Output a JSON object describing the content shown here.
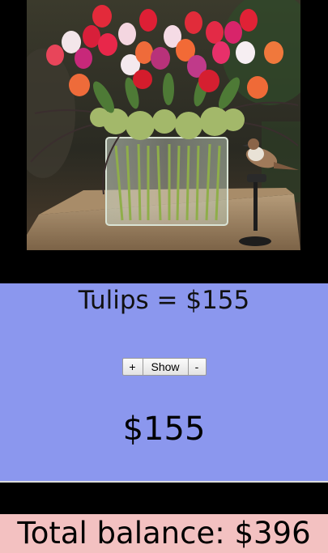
{
  "product": {
    "image_alt": "Tulip bouquet in glass vase",
    "title": "Tulips = $155",
    "amount": "$155"
  },
  "controls": {
    "plus_label": "+",
    "show_label": "Show",
    "minus_label": "-"
  },
  "total": {
    "text": "Total balance: $396"
  },
  "colors": {
    "page_background": "#000000",
    "panel_background": "#8b97ee",
    "total_background": "#f3c1c1"
  }
}
